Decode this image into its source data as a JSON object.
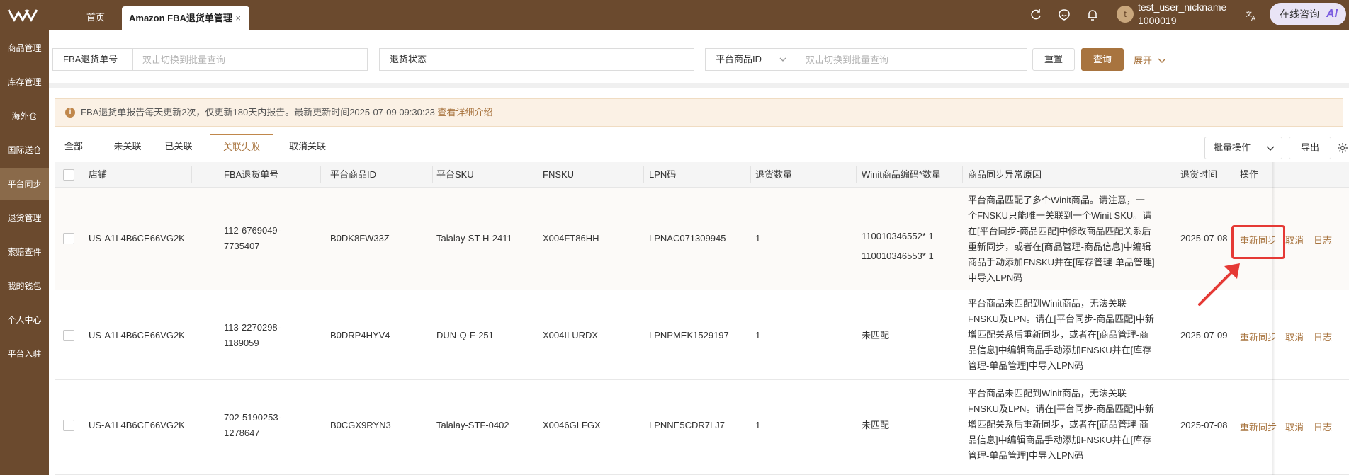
{
  "topbar": {
    "home_tab": "首页",
    "active_tab": "Amazon FBA退货单管理",
    "close_glyph": "×",
    "user_initial": "t",
    "user_name": "test_user_nickname",
    "user_id": "1000019",
    "consult_label": "在线咨询",
    "consult_ai": "AI",
    "icons": [
      "refresh-icon",
      "feedback-icon",
      "bell-icon",
      "translate-icon"
    ]
  },
  "sidebar": {
    "items": [
      "商品管理",
      "库存管理",
      "海外仓",
      "国际送仓",
      "平台同步",
      "退货管理",
      "索赔查件",
      "我的钱包",
      "个人中心",
      "平台入驻"
    ],
    "active_index": 4
  },
  "search": {
    "fba_label": "FBA退货单号",
    "fba_placeholder": "双击切换到批量查询",
    "status_label": "退货状态",
    "status_value": "",
    "platform_select": "平台商品ID",
    "platform_placeholder": "双击切换到批量查询",
    "reset": "重置",
    "query": "查询",
    "expand": "展开"
  },
  "notice": {
    "text": "FBA退货单报告每天更新2次，仅更新180天内报告。最新更新时间2025-07-09 09:30:23",
    "link": "查看详细介绍"
  },
  "tabs": [
    "全部",
    "未关联",
    "已关联",
    "关联失败",
    "取消关联"
  ],
  "active_tab_index": 3,
  "toolbar": {
    "batch": "批量操作",
    "export": "导出"
  },
  "table": {
    "headers": [
      "店铺",
      "FBA退货单号",
      "平台商品ID",
      "平台SKU",
      "FNSKU",
      "LPN码",
      "退货数量",
      "Winit商品编码*数量",
      "商品同步异常原因",
      "退货时间",
      "操作"
    ],
    "rows": [
      {
        "shop": "US-A1L4B6CE66VG2K",
        "fba_no_1": "112-6769049-",
        "fba_no_2": "7735407",
        "product_id": "B0DK8FW33Z",
        "sku": "Talalay-ST-H-2411",
        "fnsku": "X004FT86HH",
        "lpn": "LPNAC071309945",
        "qty": "1",
        "winit_1": "110010346552* 1",
        "winit_2": "110010346553* 1",
        "reason": [
          "平台商品匹配了多个Winit商品。请注意，一",
          "个FNSKU只能唯一关联到一个Winit SKU。请",
          "在[平台同步-商品匹配]中修改商品匹配关系后",
          "重新同步，或者在[商品管理-商品信息]中编辑",
          "商品手动添加FNSKU并在[库存管理-单品管理]",
          "中导入LPN码"
        ],
        "time": "2025-07-08",
        "op_resync": "重新同步",
        "op_cancel": "取消",
        "op_log": "日志"
      },
      {
        "shop": "US-A1L4B6CE66VG2K",
        "fba_no_1": "113-2270298-",
        "fba_no_2": "1189059",
        "product_id": "B0DRP4HYV4",
        "sku": "DUN-Q-F-251",
        "fnsku": "X004ILURDX",
        "lpn": "LPNPMEK1529197",
        "qty": "1",
        "winit_1": "未匹配",
        "winit_2": "",
        "reason": [
          "平台商品未匹配到Winit商品，无法关联",
          "FNSKU及LPN。请在[平台同步-商品匹配]中新",
          "增匹配关系后重新同步，或者在[商品管理-商",
          "品信息]中编辑商品手动添加FNSKU并在[库存",
          "管理-单品管理]中导入LPN码"
        ],
        "time": "2025-07-09",
        "op_resync": "重新同步",
        "op_cancel": "取消",
        "op_log": "日志"
      },
      {
        "shop": "US-A1L4B6CE66VG2K",
        "fba_no_1": "702-5190253-",
        "fba_no_2": "1278647",
        "product_id": "B0CGX9RYN3",
        "sku": "Talalay-STF-0402",
        "fnsku": "X0046GLFGX",
        "lpn": "LPNNE5CDR7LJ7",
        "qty": "1",
        "winit_1": "未匹配",
        "winit_2": "",
        "reason": [
          "平台商品未匹配到Winit商品，无法关联",
          "FNSKU及LPN。请在[平台同步-商品匹配]中新",
          "增匹配关系后重新同步，或者在[商品管理-商",
          "品信息]中编辑商品手动添加FNSKU并在[库存",
          "管理-单品管理]中导入LPN码"
        ],
        "time": "2025-07-08",
        "op_resync": "重新同步",
        "op_cancel": "取消",
        "op_log": "日志"
      }
    ]
  },
  "colors": {
    "brand": "#6b4a2e",
    "accent": "#a8743f",
    "highlight": "#e53935"
  }
}
